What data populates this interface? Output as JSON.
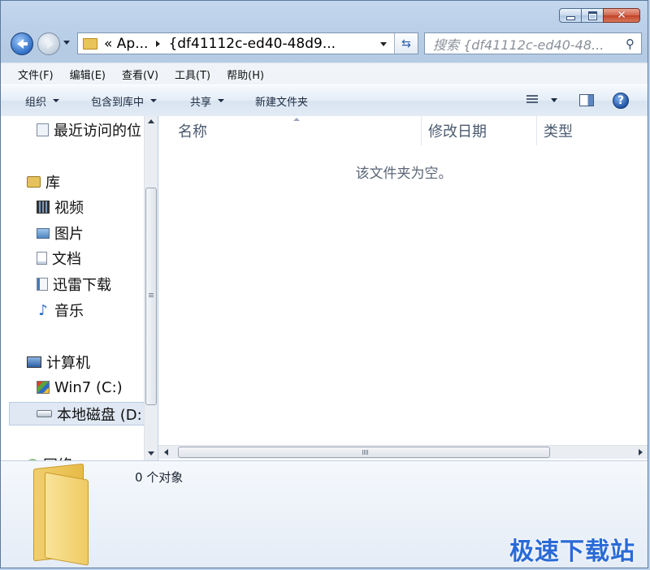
{
  "nav": {
    "breadcrumb": [
      {
        "label": "« Ap..."
      },
      {
        "label": "{df41112c-ed40-48d9..."
      }
    ]
  },
  "search": {
    "placeholder": "搜索 {df41112c-ed40-48..."
  },
  "menubar": {
    "items": [
      "文件(F)",
      "编辑(E)",
      "查看(V)",
      "工具(T)",
      "帮助(H)"
    ]
  },
  "toolbar": {
    "organize": "组织",
    "include_in_library": "包含到库中",
    "share": "共享",
    "new_folder": "新建文件夹"
  },
  "sidebar": {
    "items": [
      {
        "label": "最近访问的位",
        "icon": "recent-places-icon"
      },
      {
        "label": "库",
        "icon": "library-icon"
      },
      {
        "label": "视频",
        "icon": "video-icon"
      },
      {
        "label": "图片",
        "icon": "pictures-icon"
      },
      {
        "label": "文档",
        "icon": "documents-icon"
      },
      {
        "label": "迅雷下载",
        "icon": "thunder-download-icon"
      },
      {
        "label": "音乐",
        "icon": "music-icon"
      },
      {
        "label": "计算机",
        "icon": "computer-icon"
      },
      {
        "label": "Win7 (C:)",
        "icon": "windows-drive-icon"
      },
      {
        "label": "本地磁盘 (D:",
        "icon": "local-disk-icon",
        "selected": true
      },
      {
        "label": "网络",
        "icon": "network-icon"
      }
    ]
  },
  "content": {
    "columns": [
      "名称",
      "修改日期",
      "类型"
    ],
    "empty_message": "该文件夹为空。"
  },
  "details": {
    "item_count": "0 个对象"
  },
  "watermark": "极速下载站",
  "colors": {
    "accent": "#2a6ad6",
    "selection": "#dfe8f3",
    "window_frame": "#b5cbe4"
  }
}
